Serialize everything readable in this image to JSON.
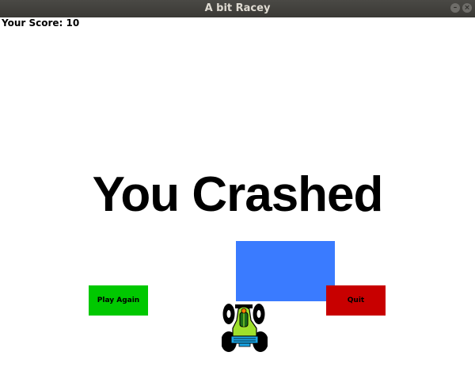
{
  "window": {
    "title": "A bit Racey"
  },
  "hud": {
    "score_label": "Your Score: 10"
  },
  "game": {
    "message": "You Crashed",
    "buttons": {
      "play_again": "Play Again",
      "quit": "Quit"
    }
  },
  "colors": {
    "obstacle": "#3a7bff",
    "play_button": "#00c800",
    "quit_button": "#c80000",
    "background": "#ffffff"
  },
  "icons": {
    "car": "race-car-icon",
    "minimize": "minimize-icon",
    "close": "close-icon"
  }
}
